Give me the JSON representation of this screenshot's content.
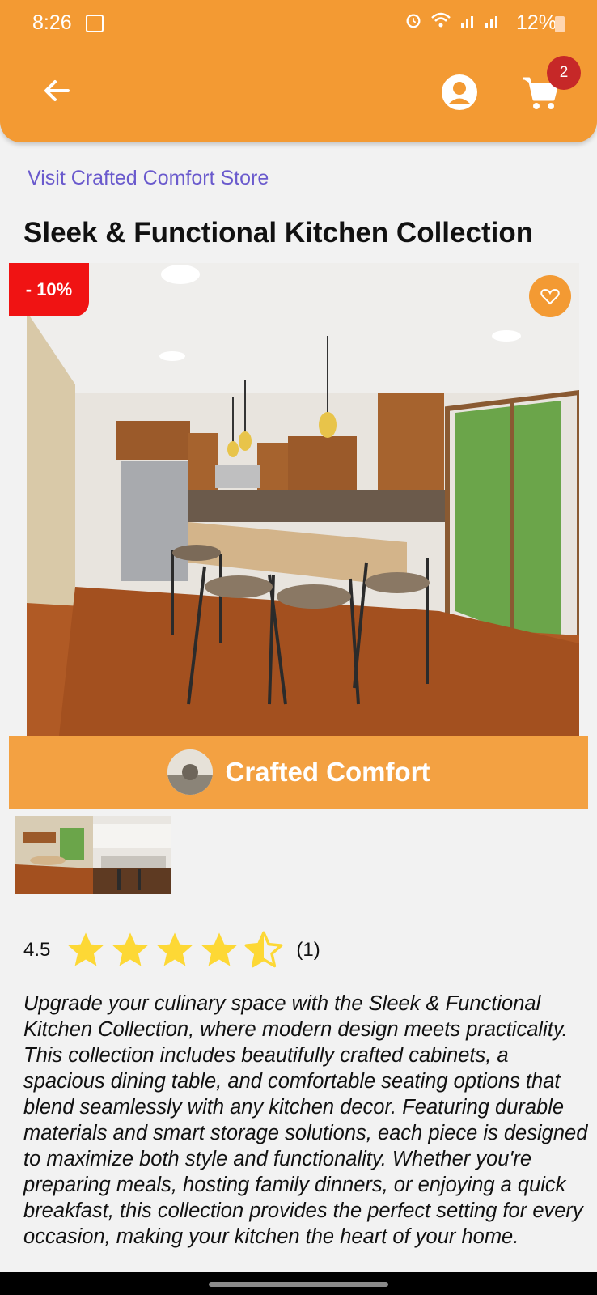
{
  "status_bar": {
    "time": "8:26",
    "battery": "12%"
  },
  "header": {
    "cart_count": "2"
  },
  "store_link": "Visit Crafted Comfort Store",
  "product": {
    "title": "Sleek & Functional Kitchen Collection",
    "discount": "- 10%",
    "seller": "Crafted Comfort",
    "rating": "4.5",
    "rating_fill": 0.9,
    "rating_count": "(1)",
    "description": "Upgrade your culinary space with the Sleek & Functional Kitchen Collection, where modern design meets practicality. This collection includes beautifully crafted cabinets, a spacious dining table, and comfortable seating options that blend seamlessly with any kitchen decor. Featuring durable materials and smart storage solutions, each piece is designed to maximize both style and functionality. Whether you're preparing meals, hosting family dinners, or enjoying a quick breakfast, this collection provides the perfect setting for every occasion, making your kitchen the heart of your home."
  },
  "colors": {
    "accent": "#f39a33",
    "discount": "#f01313",
    "link": "#6a5acd",
    "star": "#fdd835",
    "badge": "#c62828"
  }
}
